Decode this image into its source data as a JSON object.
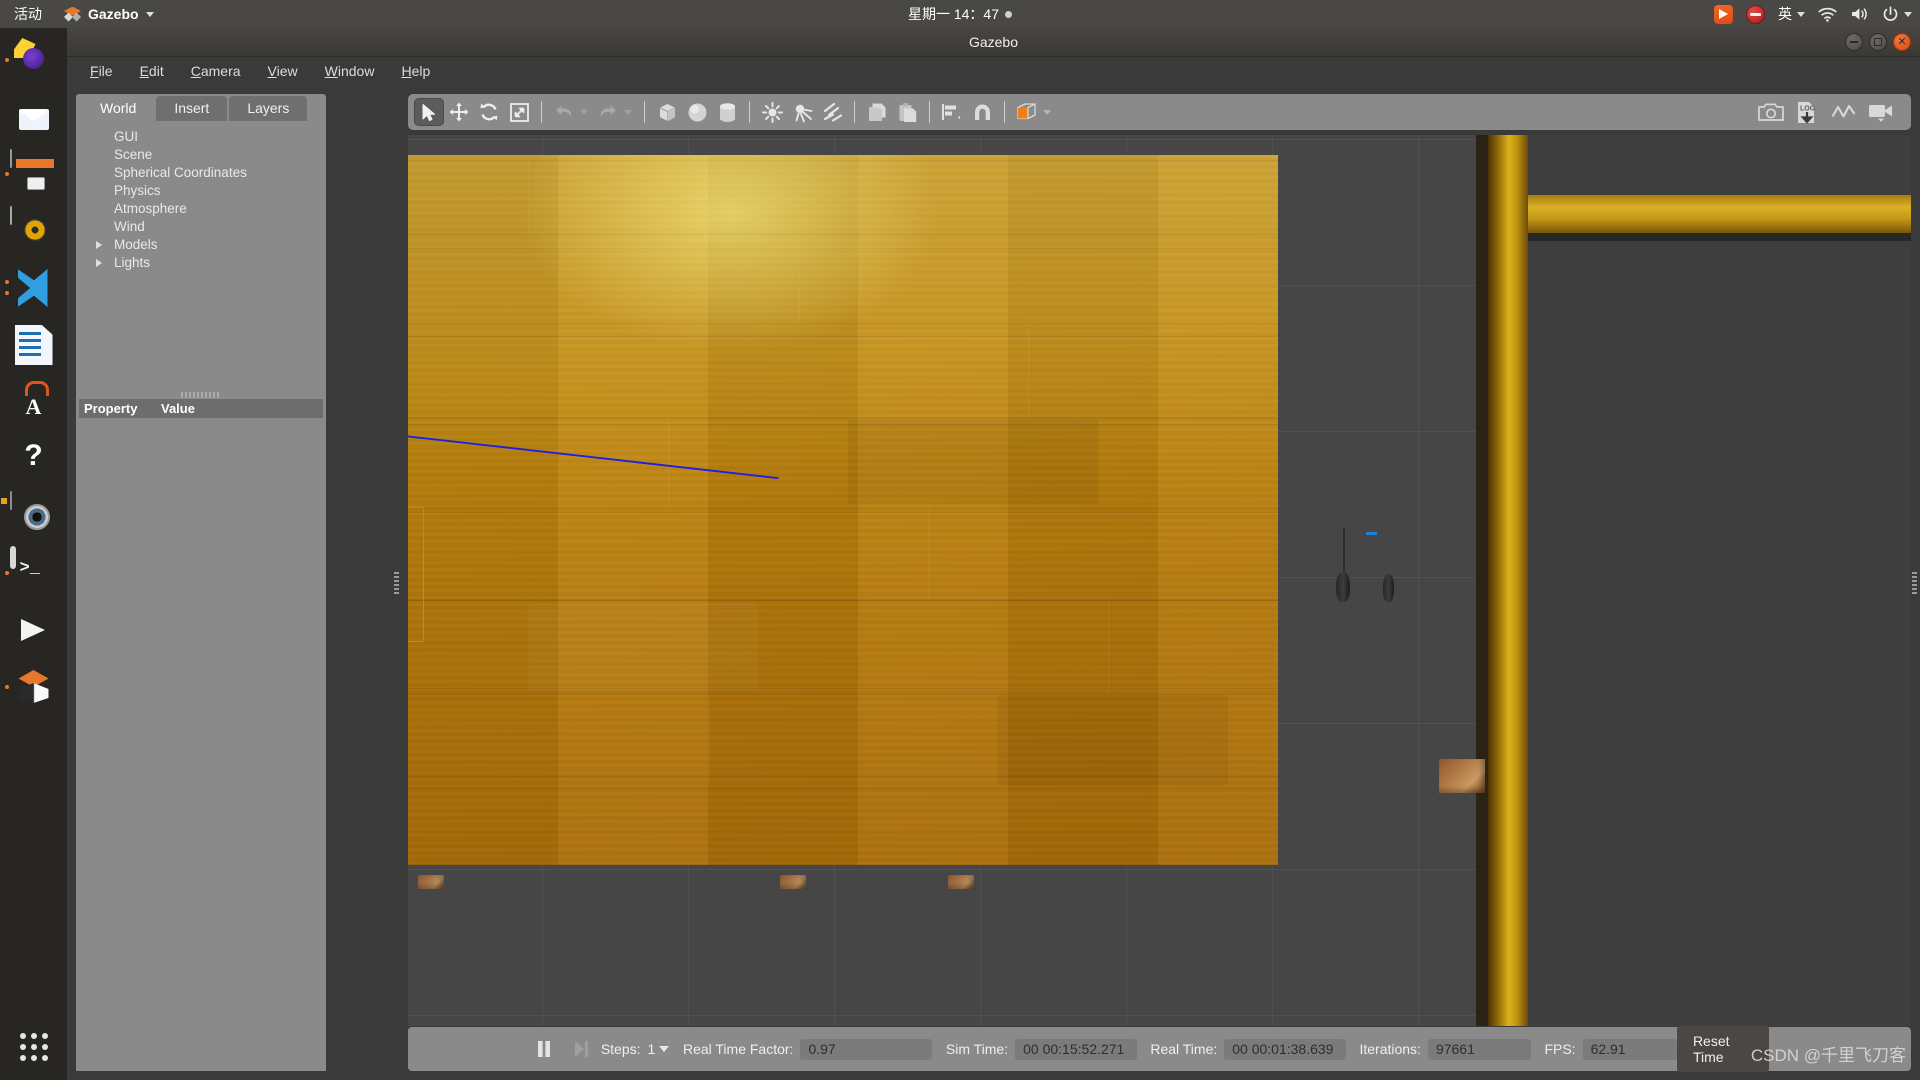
{
  "topbar": {
    "activities": "活动",
    "app_name": "Gazebo",
    "app_icon": "gazebo-logo-icon",
    "clock": "星期一 14：47",
    "tray": [
      {
        "name": "media-player-indicator",
        "icon": "media-play-icon"
      },
      {
        "name": "do-not-disturb-indicator",
        "icon": "stop-circle-icon"
      },
      {
        "name": "input-method-indicator",
        "icon": "ime-icon",
        "label": "英"
      },
      {
        "name": "network-indicator",
        "icon": "wifi-icon"
      },
      {
        "name": "volume-indicator",
        "icon": "speaker-icon"
      },
      {
        "name": "power-indicator",
        "icon": "power-icon"
      }
    ]
  },
  "dock": {
    "items": [
      {
        "name": "firefox",
        "icon": "firefox-icon",
        "running": true
      },
      {
        "name": "thunderbird",
        "icon": "thunderbird-icon",
        "running": false
      },
      {
        "name": "files",
        "icon": "file-manager-icon",
        "running": true
      },
      {
        "name": "rhythmbox",
        "icon": "music-player-icon",
        "running": false
      },
      {
        "name": "vscode",
        "icon": "vscode-icon",
        "running": true
      },
      {
        "name": "libreoffice-writer",
        "icon": "document-writer-icon",
        "running": false
      },
      {
        "name": "ubuntu-software",
        "icon": "software-store-icon",
        "running": false
      },
      {
        "name": "help",
        "icon": "help-circle-icon",
        "running": false
      },
      {
        "name": "cheese",
        "icon": "camera-icon",
        "running": false
      },
      {
        "name": "terminal",
        "icon": "terminal-icon",
        "running": true
      },
      {
        "name": "media-app",
        "icon": "media-play-icon",
        "running": false
      },
      {
        "name": "gazebo",
        "icon": "gazebo-logo-icon",
        "running": true
      }
    ],
    "show_applications": "show-applications-icon"
  },
  "window": {
    "title": "Gazebo",
    "controls": {
      "minimize": "minimize-icon",
      "maximize": "maximize-icon",
      "close": "close-icon"
    }
  },
  "menubar": {
    "items": [
      {
        "label": "File",
        "mnemonic": "F"
      },
      {
        "label": "Edit",
        "mnemonic": "E"
      },
      {
        "label": "Camera",
        "mnemonic": "C"
      },
      {
        "label": "View",
        "mnemonic": "V"
      },
      {
        "label": "Window",
        "mnemonic": "W"
      },
      {
        "label": "Help",
        "mnemonic": "H"
      }
    ]
  },
  "left_panel": {
    "tabs": [
      {
        "label": "World",
        "active": true
      },
      {
        "label": "Insert",
        "active": false
      },
      {
        "label": "Layers",
        "active": false
      }
    ],
    "tree": [
      {
        "label": "GUI",
        "expandable": false
      },
      {
        "label": "Scene",
        "expandable": false
      },
      {
        "label": "Spherical Coordinates",
        "expandable": false
      },
      {
        "label": "Physics",
        "expandable": false
      },
      {
        "label": "Atmosphere",
        "expandable": false
      },
      {
        "label": "Wind",
        "expandable": false
      },
      {
        "label": "Models",
        "expandable": true
      },
      {
        "label": "Lights",
        "expandable": true
      }
    ],
    "property_table": {
      "columns": [
        "Property",
        "Value"
      ],
      "rows": []
    }
  },
  "toolbar": {
    "left_tools": [
      {
        "name": "select-mode",
        "icon": "cursor-arrow-icon",
        "active": true
      },
      {
        "name": "translate-mode",
        "icon": "move-arrows-icon",
        "active": false
      },
      {
        "name": "rotate-mode",
        "icon": "rotate-icon",
        "active": false
      },
      {
        "name": "scale-mode",
        "icon": "scale-icon",
        "active": false
      },
      {
        "name": "undo",
        "icon": "undo-arrow-icon",
        "active": false,
        "disabled": true
      },
      {
        "name": "undo-history",
        "icon": "chevron-down-icon",
        "active": false
      },
      {
        "name": "redo",
        "icon": "redo-arrow-icon",
        "active": false,
        "disabled": true
      },
      {
        "name": "redo-history",
        "icon": "chevron-down-icon",
        "active": false
      },
      {
        "name": "insert-box",
        "icon": "cube-icon",
        "active": false
      },
      {
        "name": "insert-sphere",
        "icon": "sphere-icon",
        "active": false
      },
      {
        "name": "insert-cylinder",
        "icon": "cylinder-icon",
        "active": false
      },
      {
        "name": "insert-point-light",
        "icon": "point-light-icon",
        "active": false
      },
      {
        "name": "insert-spot-light",
        "icon": "spot-light-icon",
        "active": false
      },
      {
        "name": "insert-directional-light",
        "icon": "directional-light-icon",
        "active": false
      },
      {
        "name": "copy",
        "icon": "copy-icon",
        "active": false
      },
      {
        "name": "paste",
        "icon": "paste-icon",
        "active": false
      },
      {
        "name": "align",
        "icon": "align-icon",
        "active": false
      },
      {
        "name": "snap",
        "icon": "magnet-icon",
        "active": false
      },
      {
        "name": "change-view-angle",
        "icon": "view-cube-icon",
        "active": false
      }
    ],
    "right_tools": [
      {
        "name": "screenshot",
        "icon": "camera-icon"
      },
      {
        "name": "log-data",
        "icon": "log-download-icon",
        "label": "LOG"
      },
      {
        "name": "plotting",
        "icon": "plot-line-icon"
      },
      {
        "name": "video-record",
        "icon": "video-camera-icon"
      }
    ]
  },
  "statusbar": {
    "play_pause": {
      "name": "pause-button",
      "icon": "pause-icon"
    },
    "step": {
      "name": "step-button",
      "icon": "step-forward-icon"
    },
    "steps_label": "Steps:",
    "steps_value": "1",
    "real_time_factor_label": "Real Time Factor:",
    "real_time_factor_value": "0.97",
    "sim_time_label": "Sim Time:",
    "sim_time_value": "00 00:15:52.271",
    "real_time_label": "Real Time:",
    "real_time_value": "00 00:01:38.639",
    "iterations_label": "Iterations:",
    "iterations_value": "97661",
    "fps_label": "FPS:",
    "fps_value": "62.91",
    "reset_time_label": "Reset Time"
  },
  "viewport": {
    "selection_color": "#22dd22",
    "ray_color": "#2020e0",
    "floor_color": "#c08c12",
    "background_color": "#464646"
  },
  "watermark": "CSDN @千里飞刀客"
}
